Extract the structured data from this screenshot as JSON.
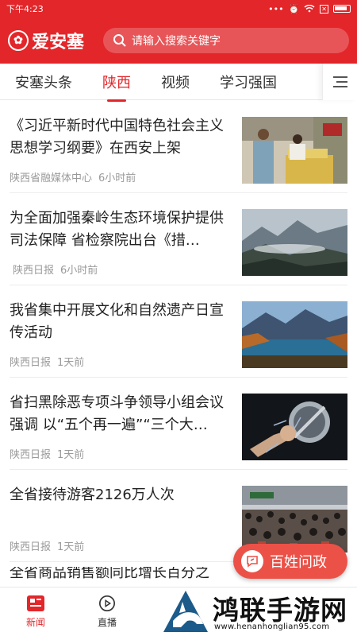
{
  "status_bar": {
    "time": "下午4:23",
    "icons": [
      "dots-icon",
      "alarm-icon",
      "wifi-icon",
      "sim-icon",
      "battery-icon"
    ]
  },
  "header": {
    "app_name": "爱安塞",
    "search_placeholder": "请输入搜索关键字",
    "brand_color": "#e2262a"
  },
  "tabs": [
    {
      "label": "安塞头条",
      "active": false
    },
    {
      "label": "陕西",
      "active": true
    },
    {
      "label": "视频",
      "active": false
    },
    {
      "label": "学习强国",
      "active": false
    }
  ],
  "feed": [
    {
      "title": "《习近平新时代中国特色社会主义思想学习纲要》在西安上架",
      "source": "陕西省融媒体中心",
      "time": "6小时前",
      "image": "bookstore-photo"
    },
    {
      "title": "为全面加强秦岭生态环境保护提供司法保障 省检察院出台《措…",
      "source": "陕西日报",
      "time": "6小时前",
      "image": "mountain-photo"
    },
    {
      "title": "我省集中开展文化和自然遗产日宣传活动",
      "source": "陕西日报",
      "time": "1天前",
      "image": "lake-photo"
    },
    {
      "title": "省扫黑除恶专项斗争领导小组会议强调 以“五个再一遍”“三个大…",
      "source": "陕西日报",
      "time": "1天前",
      "image": "fist-photo"
    },
    {
      "title": "全省接待游客2126万人次",
      "source": "陕西日报",
      "time": "1天前",
      "image": "crowd-photo"
    }
  ],
  "partial_item": {
    "title": "全省商品销售额同比增长百分之"
  },
  "fab": {
    "label": "百姓问政"
  },
  "bottom_nav": [
    {
      "label": "新闻",
      "active": true
    },
    {
      "label": "直播",
      "active": false
    }
  ],
  "watermark": {
    "name": "鸿联手游网",
    "url": "www.henanhonglian95.com"
  }
}
